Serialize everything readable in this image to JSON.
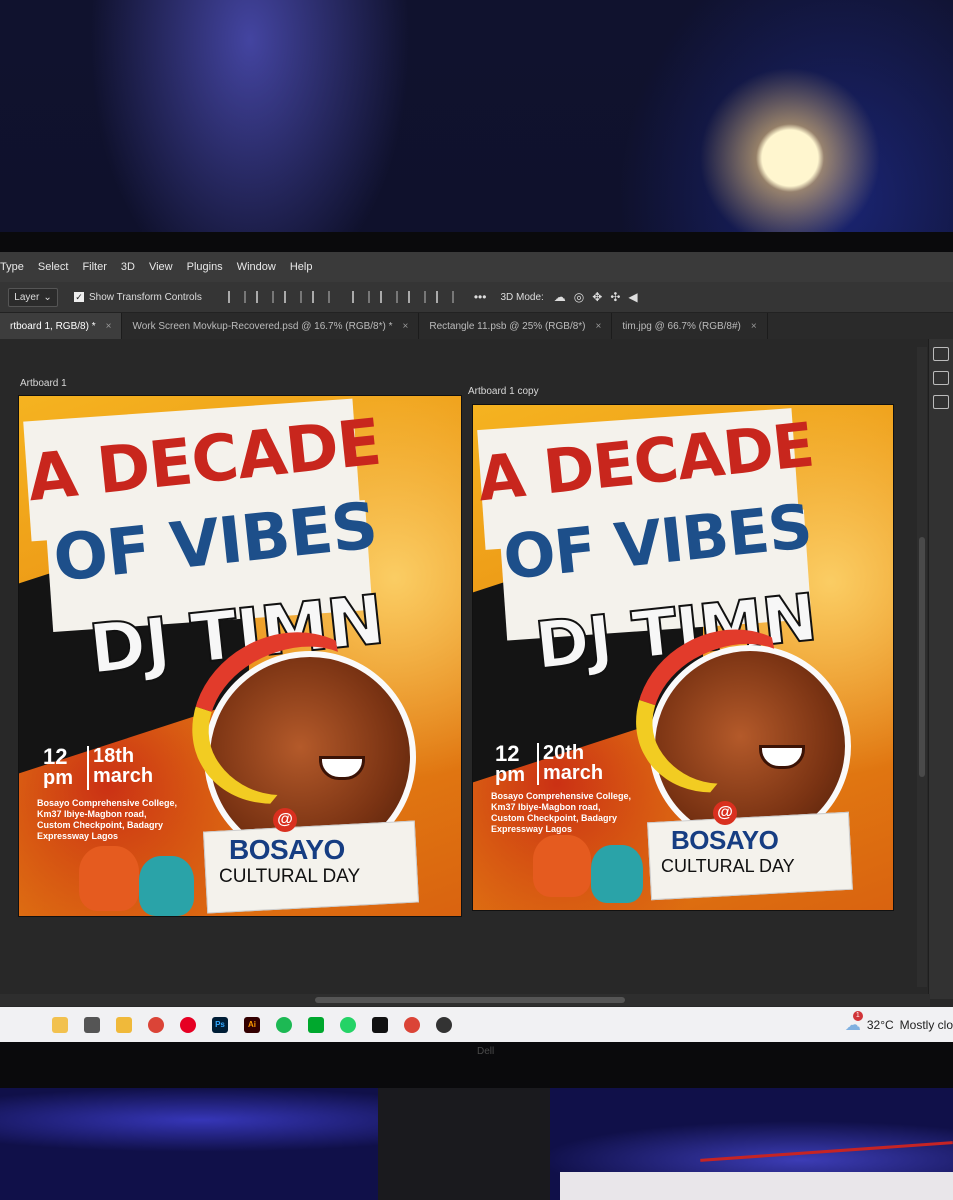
{
  "menu": [
    "Type",
    "Select",
    "Filter",
    "3D",
    "View",
    "Plugins",
    "Window",
    "Help"
  ],
  "options_bar": {
    "layer_select": "Layer",
    "show_transform_controls": "Show Transform Controls",
    "more": "•••",
    "mode_3d": "3D Mode:"
  },
  "tabs": [
    {
      "label": "rtboard 1, RGB/8) *",
      "active": true
    },
    {
      "label": "Work Screen Movkup-Recovered.psd @ 16.7% (RGB/8*) *",
      "active": false
    },
    {
      "label": "Rectangle 11.psb @ 25% (RGB/8*)",
      "active": false
    },
    {
      "label": "tim.jpg @ 66.7% (RGB/8#)",
      "active": false
    }
  ],
  "close_glyph": "×",
  "artboards": [
    {
      "label": "Artboard 1",
      "title_line1": "A DECADE",
      "title_line2": "OF VIBES",
      "title_line3": "DJ TIMN",
      "time_num": "12",
      "time_unit": "pm",
      "date_day": "18th",
      "date_month": "march",
      "venue": [
        "Bosayo Comprehensive College,",
        "Km37 Ibiye-Magbon road,",
        "Custom Checkpoint, Badagry",
        "Expressway Lagos"
      ],
      "at": "@",
      "bosayo": "BOSAYO",
      "cultural_day": "CULTURAL DAY"
    },
    {
      "label": "Artboard 1 copy",
      "title_line1": "A DECADE",
      "title_line2": "OF VIBES",
      "title_line3": "DJ TIMN",
      "time_num": "12",
      "time_unit": "pm",
      "date_day": "20th",
      "date_month": "march",
      "venue": [
        "Bosayo Comprehensive College,",
        "Km37 Ibiye-Magbon road,",
        "Custom Checkpoint, Badagry",
        "Expressway Lagos"
      ],
      "at": "@",
      "bosayo": "BOSAYO",
      "cultural_day": "CULTURAL DAY"
    }
  ],
  "taskbar": {
    "apps": [
      "copilot-icon",
      "task-view-icon",
      "file-explorer-icon",
      "chrome-icon",
      "pinterest-icon",
      "photoshop-icon",
      "illustrator-icon",
      "spotify-icon",
      "evernote-icon",
      "whatsapp-icon",
      "capcut-icon",
      "chrome-icon",
      "snipping-icon"
    ],
    "ps_label": "Ps",
    "ai_label": "Ai",
    "weather_temp": "32°C",
    "weather_text": "Mostly clo",
    "notification_badge": "1"
  },
  "bezel_brand": "Dell",
  "colors": {
    "title_red": "#c8261d",
    "title_blue": "#1d4f8a",
    "poster_orange": "#f3a51b",
    "ps_dark": "#282828"
  }
}
